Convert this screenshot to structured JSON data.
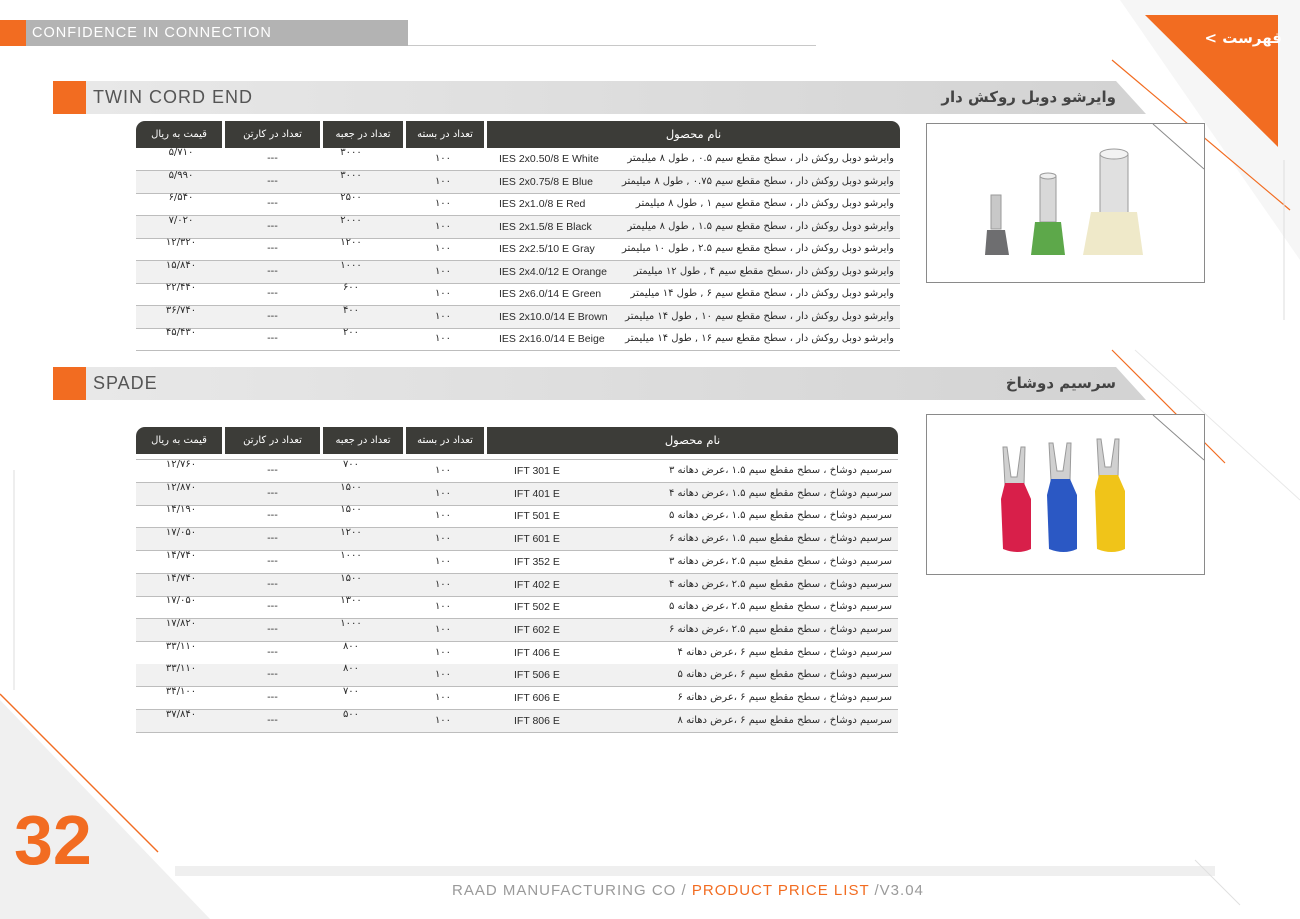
{
  "header": {
    "tagline": "CONFIDENCE IN CONNECTION",
    "index_label": "فهرست >"
  },
  "colors": {
    "accent": "#f26c21",
    "table_head": "#3c3c38",
    "bar_gray": "#d3d3d3"
  },
  "columns": {
    "name": "نام محصول",
    "pack": "تعداد در بسته",
    "box": "تعداد در جعبه",
    "carton": "تعداد در کارتن",
    "price": "قیمت به ریال"
  },
  "section1": {
    "title_en": "TWIN CORD END",
    "title_fa": "وایرشو دوبل روکش دار",
    "image_icon": "twin-cord-end-ferrules-photo",
    "rows": [
      {
        "name": "وایرشو دوبل روکش دار ، سطح مقطع  سیم  ۰.۵ , طول ۸ میلیمتر",
        "code": "IES 2x0.50/8 E White",
        "pack": "۱۰۰",
        "box": "۳۰۰۰",
        "carton": "---",
        "price": "۵/۷۱۰"
      },
      {
        "name": "وایرشو دوبل روکش دار ، سطح مقطع  سیم  ۰.۷۵ , طول ۸ میلیمتر",
        "code": "IES 2x0.75/8 E Blue",
        "pack": "۱۰۰",
        "box": "۳۰۰۰",
        "carton": "---",
        "price": "۵/۹۹۰"
      },
      {
        "name": "وایرشو دوبل روکش دار ، سطح مقطع  سیم  ۱ , طول ۸ میلیمتر",
        "code": "IES 2x1.0/8 E Red",
        "pack": "۱۰۰",
        "box": "۲۵۰۰",
        "carton": "---",
        "price": "۶/۵۴۰"
      },
      {
        "name": "وایرشو دوبل روکش دار ، سطح مقطع  سیم  ۱.۵ , طول ۸ میلیمتر",
        "code": "IES 2x1.5/8 E Black",
        "pack": "۱۰۰",
        "box": "۲۰۰۰",
        "carton": "---",
        "price": "۷/۰۲۰"
      },
      {
        "name": "وایرشو دوبل روکش دار ، سطح مقطع  سیم  ۲.۵ , طول ۱۰ میلیمتر",
        "code": "IES 2x2.5/10 E Gray",
        "pack": "۱۰۰",
        "box": "۱۲۰۰",
        "carton": "---",
        "price": "۱۲/۳۲۰"
      },
      {
        "name": "وایرشو دوبل روکش دار ،سطح مقطع  سیم  ۴ , طول ۱۲ میلیمتر",
        "code": "IES 2x4.0/12 E Orange",
        "pack": "۱۰۰",
        "box": "۱۰۰۰",
        "carton": "---",
        "price": "۱۵/۸۴۰"
      },
      {
        "name": "وایرشو دوبل روکش دار ، سطح مقطع  سیم  ۶ , طول ۱۴ میلیمتر",
        "code": "IES 2x6.0/14 E Green",
        "pack": "۱۰۰",
        "box": "۶۰۰",
        "carton": "---",
        "price": "۲۲/۴۴۰"
      },
      {
        "name": "وایرشو دوبل روکش دار ، سطح مقطع  سیم  ۱۰ , طول ۱۴ میلیمتر",
        "code": "IES 2x10.0/14 E Brown",
        "pack": "۱۰۰",
        "box": "۴۰۰",
        "carton": "---",
        "price": "۳۶/۷۴۰"
      },
      {
        "name": "وایرشو دوبل روکش دار ، سطح مقطع  سیم  ۱۶ , طول ۱۴ میلیمتر",
        "code": "IES 2x16.0/14 E Beige",
        "pack": "۱۰۰",
        "box": "۲۰۰",
        "carton": "---",
        "price": "۴۵/۴۳۰"
      }
    ]
  },
  "section2": {
    "title_en": "SPADE",
    "title_fa": "سرسیم دوشاخ",
    "image_icon": "spade-terminals-photo",
    "rows": [
      {
        "name": "سرسیم دوشاخ ، سطح مقطع سیم ۱.۵ ،عرض دهانه ۳",
        "code": "IFT 301 E",
        "pack": "۱۰۰",
        "box": "۷۰۰",
        "carton": "---",
        "price": "۱۲/۷۶۰"
      },
      {
        "name": "سرسیم دوشاخ ، سطح مقطع سیم ۱.۵ ،عرض دهانه ۴",
        "code": "IFT 401 E",
        "pack": "۱۰۰",
        "box": "۱۵۰۰",
        "carton": "---",
        "price": "۱۲/۸۷۰"
      },
      {
        "name": "سرسیم دوشاخ ، سطح مقطع سیم ۱.۵ ،عرض دهانه ۵",
        "code": "IFT 501 E",
        "pack": "۱۰۰",
        "box": "۱۵۰۰",
        "carton": "---",
        "price": "۱۴/۱۹۰"
      },
      {
        "name": "سرسیم دوشاخ ، سطح مقطع سیم ۱.۵ ،عرض دهانه ۶",
        "code": "IFT 601 E",
        "pack": "۱۰۰",
        "box": "۱۲۰۰",
        "carton": "---",
        "price": "۱۷/۰۵۰"
      },
      {
        "name": "سرسیم دوشاخ ، سطح مقطع سیم ۲.۵ ،عرض دهانه ۳",
        "code": "IFT 352 E",
        "pack": "۱۰۰",
        "box": "۱۰۰۰",
        "carton": "---",
        "price": "۱۴/۷۴۰"
      },
      {
        "name": "سرسیم دوشاخ ، سطح مقطع سیم ۲.۵ ،عرض دهانه ۴",
        "code": "IFT 402 E",
        "pack": "۱۰۰",
        "box": "۱۵۰۰",
        "carton": "---",
        "price": "۱۴/۷۴۰"
      },
      {
        "name": "سرسیم دوشاخ ، سطح مقطع سیم ۲.۵ ،عرض دهانه ۵",
        "code": "IFT 502 E",
        "pack": "۱۰۰",
        "box": "۱۳۰۰",
        "carton": "---",
        "price": "۱۷/۰۵۰"
      },
      {
        "name": "سرسیم دوشاخ ، سطح مقطع سیم ۲.۵ ،عرض دهانه ۶",
        "code": "IFT 602 E",
        "pack": "۱۰۰",
        "box": "۱۰۰۰",
        "carton": "---",
        "price": "۱۷/۸۲۰"
      },
      {
        "name": "سرسیم دوشاخ ، سطح مقطع سیم ۶ ،عرض دهانه ۴",
        "code": "IFT 406 E",
        "pack": "۱۰۰",
        "box": "۸۰۰",
        "carton": "---",
        "price": "۳۳/۱۱۰"
      },
      {
        "name": "سرسیم دوشاخ ، سطح مقطع سیم ۶ ،عرض دهانه ۵",
        "code": "IFT 506 E",
        "pack": "۱۰۰",
        "box": "۸۰۰",
        "carton": "---",
        "price": "۳۳/۱۱۰"
      },
      {
        "name": "سرسیم دوشاخ ، سطح مقطع سیم ۶ ،عرض دهانه ۶",
        "code": "IFT 606 E",
        "pack": "۱۰۰",
        "box": "۷۰۰",
        "carton": "---",
        "price": "۳۴/۱۰۰"
      },
      {
        "name": "سرسیم دوشاخ ، سطح مقطع سیم ۶ ،عرض دهانه ۸",
        "code": "IFT 806 E",
        "pack": "۱۰۰",
        "box": "۵۰۰",
        "carton": "---",
        "price": "۳۷/۸۴۰"
      }
    ]
  },
  "footer": {
    "company": "RAAD MANUFACTURING CO / ",
    "doc": "PRODUCT PRICE LIST",
    "version": " /V3.04"
  },
  "page_number": "32"
}
